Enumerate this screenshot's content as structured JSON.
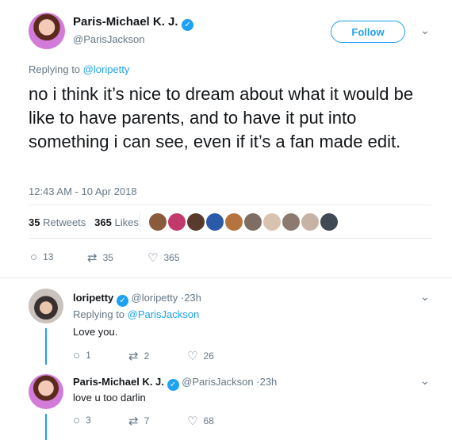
{
  "main_tweet": {
    "display_name": "Paris-Michael K. J.",
    "handle": "@ParisJackson",
    "follow_label": "Follow",
    "replying_prefix": "Replying to",
    "replying_to": "@loripetty",
    "text": "no i think it’s nice to dream about what it would be like to have parents, and to have it put into something i can see, even if it’s a fan made edit.",
    "timestamp": "12:43 AM - 10 Apr 2018",
    "retweets_count": "35",
    "retweets_label": "Retweets",
    "likes_count": "365",
    "likes_label": "Likes",
    "actions": {
      "replies": "13",
      "retweets": "35",
      "likes": "365"
    }
  },
  "replies": [
    {
      "display_name": "loripetty",
      "handle_time": "@loripetty ·23h",
      "replying_prefix": "Replying to",
      "replying_to": "@ParisJackson",
      "text": "Love you.",
      "actions": {
        "replies": "1",
        "retweets": "2",
        "likes": "26"
      }
    },
    {
      "display_name": "Paris-Michael K. J.",
      "handle_time": "@ParisJackson ·23h",
      "text": "love u too darlin",
      "actions": {
        "replies": "3",
        "retweets": "7",
        "likes": "68"
      }
    }
  ],
  "colors": {
    "accent": "#1da1f2",
    "muted": "#657786",
    "text": "#14171a"
  },
  "icons": {
    "verified": "✓",
    "chevron": "⌄",
    "reply": "○",
    "retweet": "⇄",
    "like": "♡"
  },
  "liked_by_avatars": [
    "#8a5a3c",
    "#c23a6b",
    "#5b3a2e",
    "#2b5aa8",
    "#b5743f",
    "#7d6d62",
    "#d9c3b0",
    "#8c7a70",
    "#c7b3a6",
    "#3f4a55"
  ]
}
